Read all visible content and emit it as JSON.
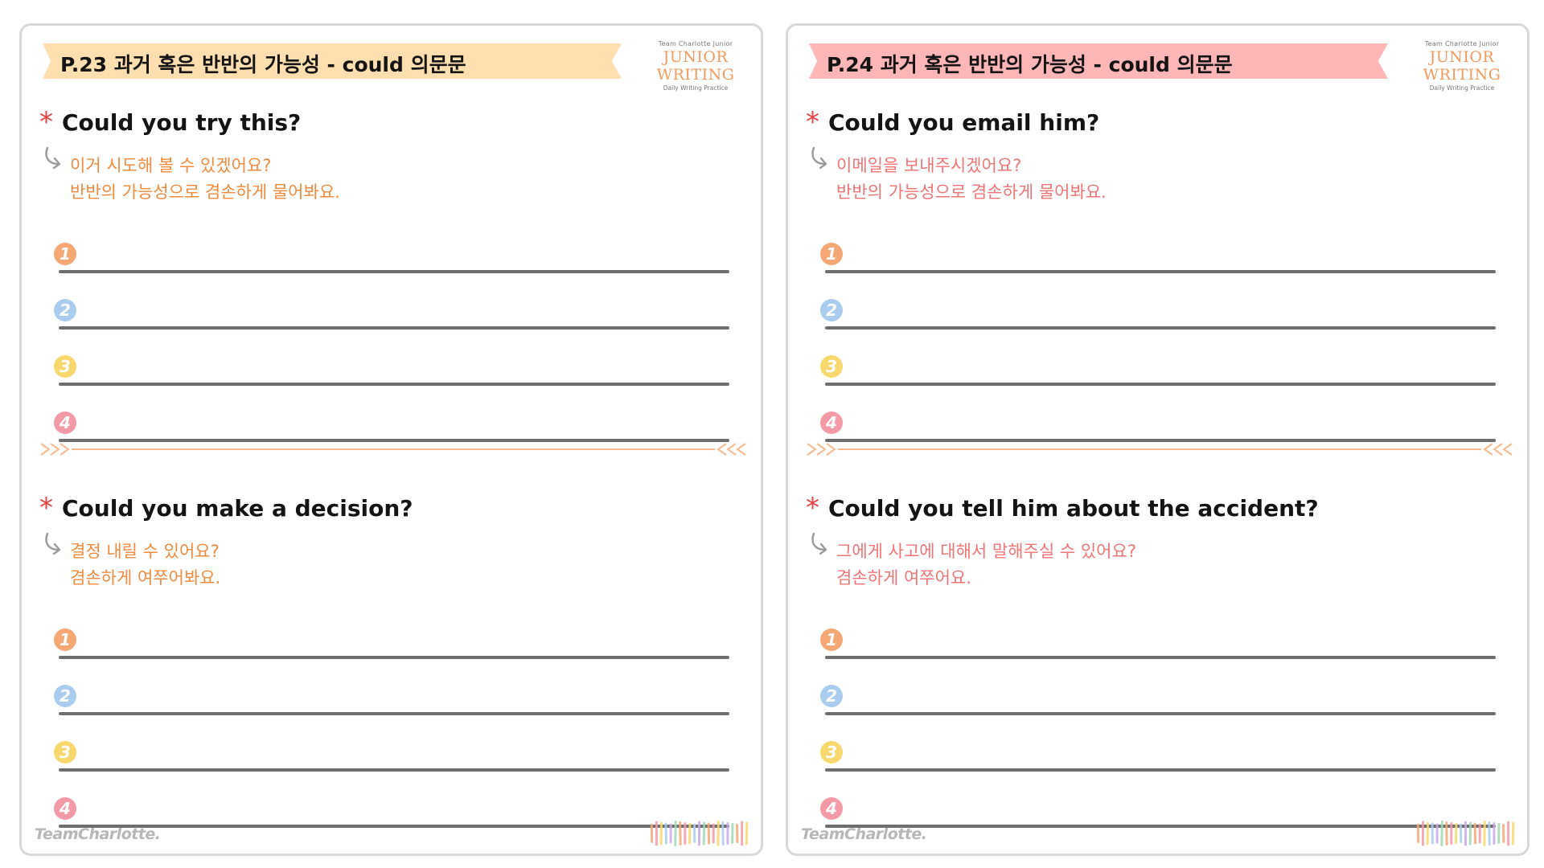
{
  "pages": [
    {
      "title": "P.23 과거 혹은 반반의 가능성 - could 의문문",
      "ribbon_color": "#ffdfb0",
      "brand": {
        "top": "Team Charlotte Junior",
        "main": "JUNIOR WRITING",
        "sub": "Daily Writing Practice"
      },
      "questions": [
        {
          "star": "*",
          "text": "Could you try this?",
          "kr_line1": "이거 시도해 볼 수 있겠어요?",
          "kr_line2": "반반의 가능성으로 겸손하게 물어봐요."
        },
        {
          "star": "*",
          "text": "Could you make a decision?",
          "kr_line1": "결정 내릴 수 있어요?",
          "kr_line2": "겸손하게 여쭈어봐요."
        }
      ],
      "footer_logo": "TeamCharlotte."
    },
    {
      "title": "P.24 과거 혹은 반반의 가능성 - could 의문문",
      "ribbon_color": "#ffb6b6",
      "brand": {
        "top": "Team Charlotte Junior",
        "main": "JUNIOR WRITING",
        "sub": "Daily Writing Practice"
      },
      "questions": [
        {
          "star": "*",
          "text": "Could you email him?",
          "kr_line1": "이메일을 보내주시겠어요?",
          "kr_line2": "반반의 가능성으로 겸손하게 물어봐요."
        },
        {
          "star": "*",
          "text": "Could you tell him about the accident?",
          "kr_line1": "그에게 사고에 대해서 말해주실 수 있어요?",
          "kr_line2": "겸손하게 여쭈어요."
        }
      ],
      "footer_logo": "TeamCharlotte."
    }
  ],
  "answer_numbers": [
    "1",
    "2",
    "3",
    "4"
  ],
  "number_colors": [
    "#f5a873",
    "#a9cdef",
    "#f8d86c",
    "#f49aa6"
  ],
  "stripe_colors": [
    "#f5a873",
    "#f49aa6",
    "#f8d86c",
    "#a9cdef",
    "#c9a9e9",
    "#9fd9b0"
  ],
  "divider_color": "#f9b98c"
}
